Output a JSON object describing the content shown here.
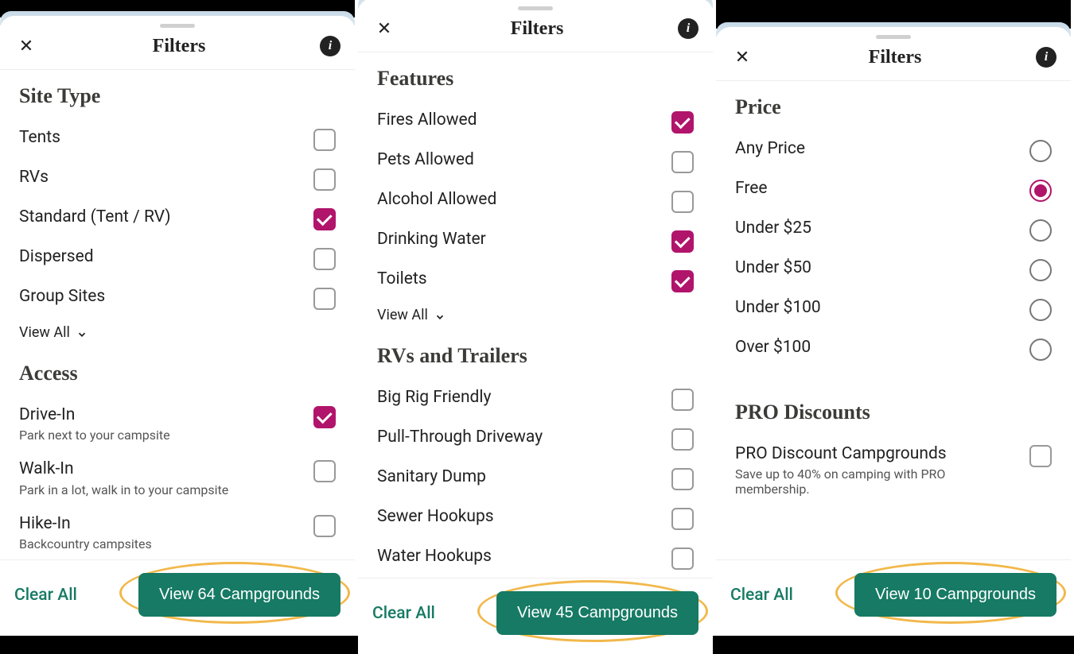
{
  "header": {
    "title": "Filters",
    "close_glyph": "✕",
    "info_glyph": "i"
  },
  "view_all_label": "View All",
  "footer": {
    "clear_label": "Clear All"
  },
  "panels": [
    {
      "cta_label": "View 64 Campgrounds",
      "sections": [
        {
          "title": "Site Type",
          "show_view_all": true,
          "options": [
            {
              "label": "Tents",
              "control": "checkbox",
              "checked": false
            },
            {
              "label": "RVs",
              "control": "checkbox",
              "checked": false
            },
            {
              "label": "Standard (Tent / RV)",
              "control": "checkbox",
              "checked": true
            },
            {
              "label": "Dispersed",
              "control": "checkbox",
              "checked": false
            },
            {
              "label": "Group Sites",
              "control": "checkbox",
              "checked": false
            }
          ]
        },
        {
          "title": "Access",
          "show_view_all": false,
          "options": [
            {
              "label": "Drive-In",
              "sub": "Park next to your campsite",
              "control": "checkbox",
              "checked": true
            },
            {
              "label": "Walk-In",
              "sub": "Park in a lot, walk in to your campsite",
              "control": "checkbox",
              "checked": false
            },
            {
              "label": "Hike-In",
              "sub": "Backcountry campsites",
              "control": "checkbox",
              "checked": false
            }
          ]
        }
      ]
    },
    {
      "cta_label": "View 45 Campgrounds",
      "sections": [
        {
          "title": "Features",
          "show_view_all": true,
          "options": [
            {
              "label": "Fires Allowed",
              "control": "checkbox",
              "checked": true
            },
            {
              "label": "Pets Allowed",
              "control": "checkbox",
              "checked": false
            },
            {
              "label": "Alcohol Allowed",
              "control": "checkbox",
              "checked": false
            },
            {
              "label": "Drinking Water",
              "control": "checkbox",
              "checked": true
            },
            {
              "label": "Toilets",
              "control": "checkbox",
              "checked": true
            }
          ]
        },
        {
          "title": "RVs and Trailers",
          "show_view_all": false,
          "options": [
            {
              "label": "Big Rig Friendly",
              "control": "checkbox",
              "checked": false
            },
            {
              "label": "Pull-Through Driveway",
              "control": "checkbox",
              "checked": false
            },
            {
              "label": "Sanitary Dump",
              "control": "checkbox",
              "checked": false
            },
            {
              "label": "Sewer Hookups",
              "control": "checkbox",
              "checked": false
            },
            {
              "label": "Water Hookups",
              "control": "checkbox",
              "checked": false
            }
          ]
        }
      ]
    },
    {
      "cta_label": "View 10 Campgrounds",
      "sections": [
        {
          "title": "Price",
          "show_view_all": false,
          "options": [
            {
              "label": "Any Price",
              "control": "radio",
              "checked": false
            },
            {
              "label": "Free",
              "control": "radio",
              "checked": true
            },
            {
              "label": "Under $25",
              "control": "radio",
              "checked": false
            },
            {
              "label": "Under $50",
              "control": "radio",
              "checked": false
            },
            {
              "label": "Under $100",
              "control": "radio",
              "checked": false
            },
            {
              "label": "Over $100",
              "control": "radio",
              "checked": false
            }
          ]
        },
        {
          "title": "PRO Discounts",
          "show_view_all": false,
          "options": [
            {
              "label": "PRO Discount Campgrounds",
              "sub": "Save up to 40% on camping with PRO membership.",
              "control": "checkbox",
              "checked": false
            }
          ]
        }
      ]
    }
  ]
}
